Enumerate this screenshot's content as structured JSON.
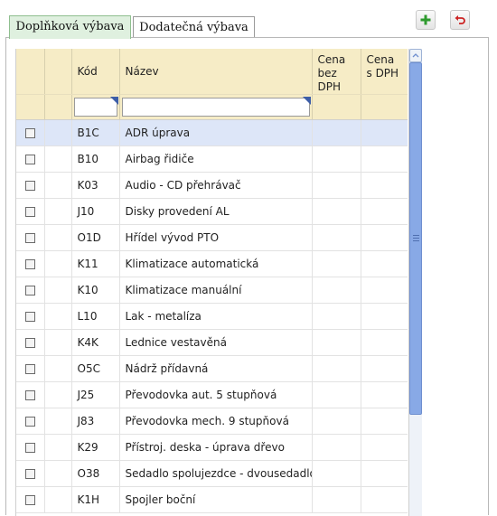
{
  "tabs": [
    {
      "label": "Doplňková výbava",
      "active": true
    },
    {
      "label": "Dodatečná výbava",
      "active": false
    }
  ],
  "toolbar": {
    "add_icon": "plus-icon",
    "undo_icon": "undo-icon",
    "accent": "#2e9a2e",
    "undo_color": "#cc2222"
  },
  "grid": {
    "columns": {
      "code": "Kód",
      "name": "Název",
      "price_net_1": "Cena",
      "price_net_2": "bez DPH",
      "price_gross_1": "Cena",
      "price_gross_2": "s DPH"
    },
    "filters": {
      "code": "",
      "name": ""
    },
    "rows": [
      {
        "code": "B1C",
        "name": "ADR úprava",
        "selected": true
      },
      {
        "code": "B10",
        "name": "Airbag řidiče"
      },
      {
        "code": "K03",
        "name": "Audio - CD přehrávač"
      },
      {
        "code": "J10",
        "name": "Disky provedení AL"
      },
      {
        "code": "O1D",
        "name": "Hřídel vývod PTO"
      },
      {
        "code": "K11",
        "name": "Klimatizace automatická"
      },
      {
        "code": "K10",
        "name": "Klimatizace manuální"
      },
      {
        "code": "L10",
        "name": "Lak - metalíza"
      },
      {
        "code": "K4K",
        "name": "Lednice vestavěná"
      },
      {
        "code": "O5C",
        "name": "Nádrž přídavná"
      },
      {
        "code": "J25",
        "name": "Převodovka aut. 5 stupňová"
      },
      {
        "code": "J83",
        "name": "Převodovka mech. 9 stupňová"
      },
      {
        "code": "K29",
        "name": "Přístroj. deska - úprava dřevo"
      },
      {
        "code": "O38",
        "name": "Sedadlo spolujezdce - dvousedadlo"
      },
      {
        "code": "K1H",
        "name": "Spojler boční"
      }
    ]
  }
}
